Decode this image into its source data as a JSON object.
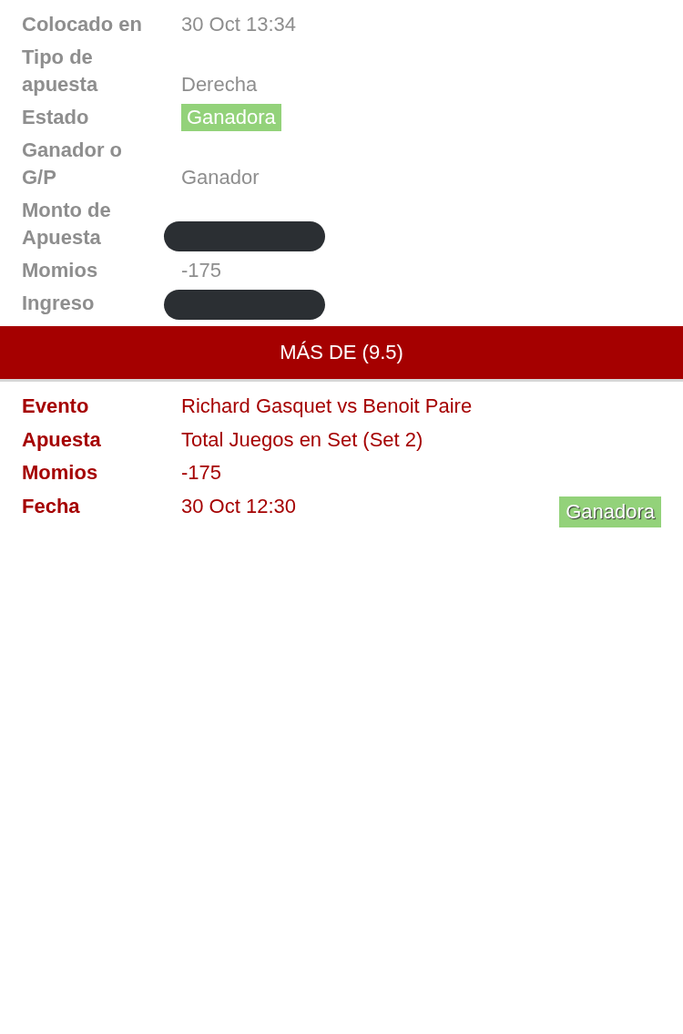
{
  "summary": [
    {
      "label": "Colocado en",
      "kind": "text",
      "value": "30 Oct 13:34"
    },
    {
      "label": "Tipo de apuesta",
      "kind": "text",
      "value": "Derecha"
    },
    {
      "label": "Estado",
      "kind": "badge",
      "value": "Ganadora"
    },
    {
      "label": "Ganador o G/P",
      "kind": "text",
      "value": "Ganador"
    },
    {
      "label": "Monto de Apuesta",
      "kind": "redacted"
    },
    {
      "label": "Momios",
      "kind": "text",
      "value": "-175"
    },
    {
      "label": "Ingreso",
      "kind": "redacted"
    }
  ],
  "selection": {
    "title": "MÁS DE (9.5)",
    "details": [
      {
        "label": "Evento",
        "value": "Richard Gasquet vs Benoit Paire"
      },
      {
        "label": "Apuesta",
        "value": "Total Juegos en Set (Set 2)"
      },
      {
        "label": "Momios",
        "value": "-175"
      },
      {
        "label": "Fecha",
        "value": "30 Oct 12:30"
      }
    ],
    "result": "Ganadora"
  }
}
